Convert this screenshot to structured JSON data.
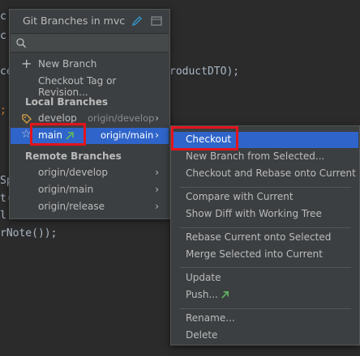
{
  "editor": {
    "fragments": [
      {
        "text": "c"
      },
      {
        "text": "c"
      },
      {
        "text": "ce"
      },
      {
        "text": "roductDTO);"
      },
      {
        "text": "Sp"
      },
      {
        "text": "t("
      },
      {
        "text": "l"
      },
      {
        "text": "rNote());"
      }
    ]
  },
  "popup": {
    "title": "Git Branches in mvc",
    "search_placeholder": "",
    "actions": [
      "New Branch",
      "Checkout Tag or Revision..."
    ],
    "local_header": "Local Branches",
    "local": [
      {
        "name": "develop",
        "tracking": "origin/develop"
      },
      {
        "name": "main",
        "tracking": "origin/main"
      }
    ],
    "remote_header": "Remote Branches",
    "remote": [
      "origin/develop",
      "origin/main",
      "origin/release"
    ]
  },
  "submenu": {
    "items": [
      "Checkout",
      "New Branch from Selected...",
      "Checkout and Rebase onto Current",
      "Compare with Current",
      "Show Diff with Working Tree",
      "Rebase Current onto Selected",
      "Merge Selected into Current",
      "Update",
      "Push...",
      "Rename...",
      "Delete"
    ]
  },
  "colors": {
    "accent": "#2f65ca",
    "highlight": "#e3141c",
    "incoming_arrow": "#5fb35f"
  }
}
